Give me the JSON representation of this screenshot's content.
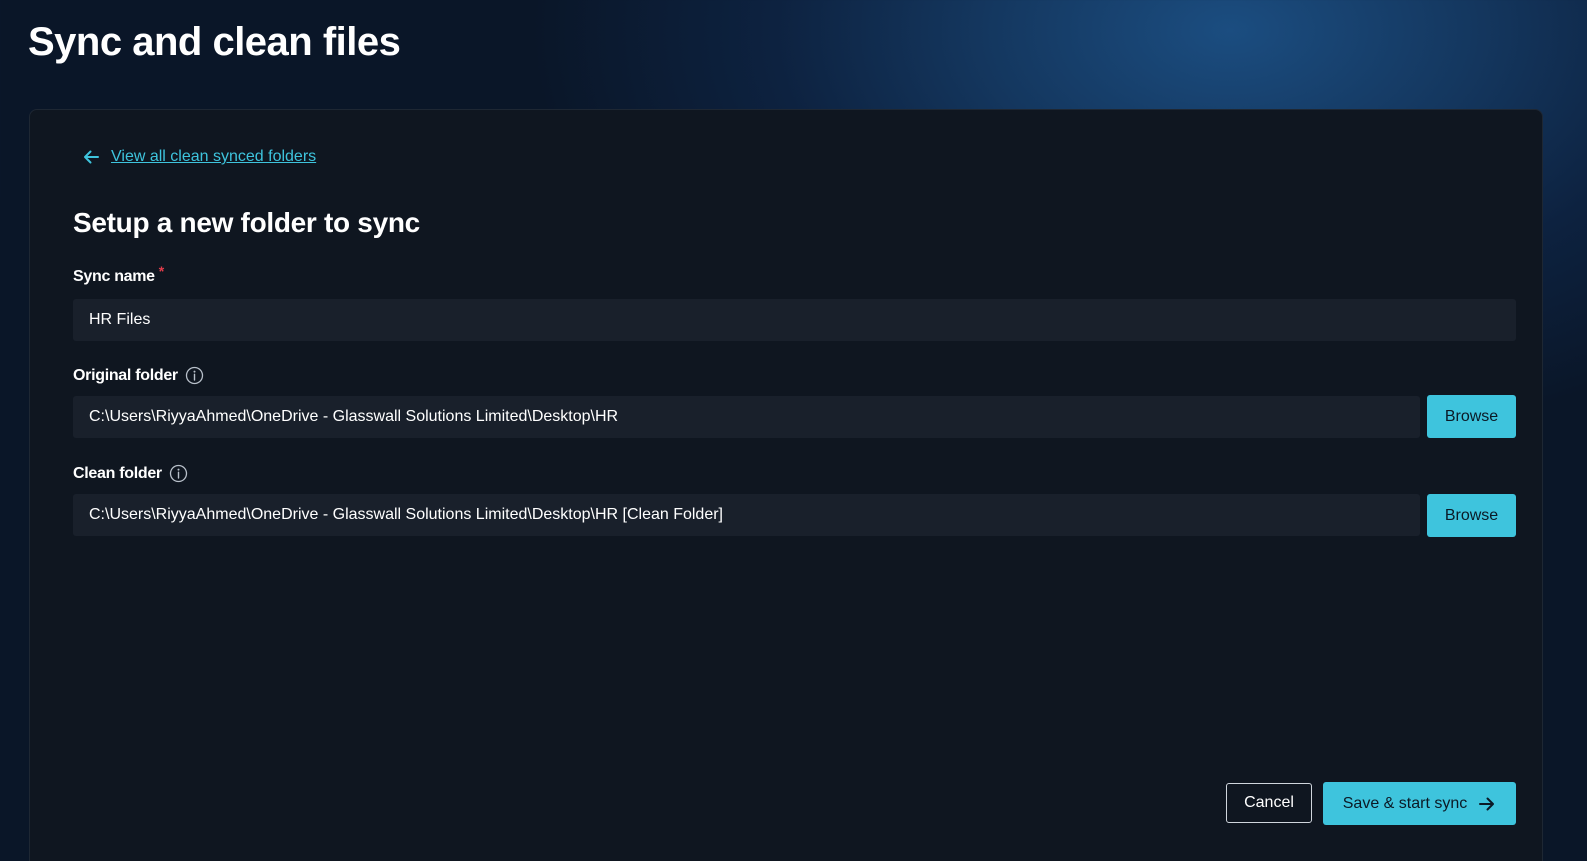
{
  "page": {
    "title": "Sync and clean files"
  },
  "back_link": {
    "label": "View all clean synced folders",
    "icon": "arrow-left-icon"
  },
  "form": {
    "title": "Setup a new folder to sync",
    "sync_name": {
      "label": "Sync name",
      "required_marker": "*",
      "value": "HR Files"
    },
    "original_folder": {
      "label": "Original folder",
      "icon": "info-icon",
      "value": "C:\\Users\\RiyyaAhmed\\OneDrive - Glasswall Solutions Limited\\Desktop\\HR",
      "browse_label": "Browse"
    },
    "clean_folder": {
      "label": "Clean folder",
      "icon": "info-icon",
      "value": "C:\\Users\\RiyyaAhmed\\OneDrive - Glasswall Solutions Limited\\Desktop\\HR [Clean Folder]",
      "browse_label": "Browse"
    }
  },
  "actions": {
    "cancel_label": "Cancel",
    "save_label": "Save & start sync",
    "save_icon": "arrow-right-icon"
  },
  "colors": {
    "accent": "#3ec4dd",
    "panel_bg": "#0f1620",
    "input_bg": "#19202b",
    "required": "#e23c4b"
  }
}
